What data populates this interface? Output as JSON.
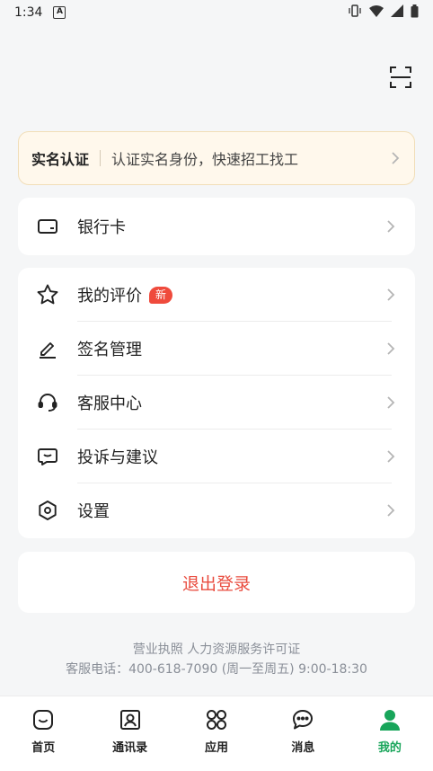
{
  "status_bar": {
    "time": "1:34",
    "notif_letter": "A"
  },
  "verify": {
    "title": "实名认证",
    "desc": "认证实名身份，快速招工找工"
  },
  "bank": {
    "label": "银行卡"
  },
  "menu": {
    "reviews": {
      "label": "我的评价",
      "badge": "新"
    },
    "signature": {
      "label": "签名管理"
    },
    "service": {
      "label": "客服中心"
    },
    "complaint": {
      "label": "投诉与建议"
    },
    "settings": {
      "label": "设置"
    }
  },
  "logout": {
    "label": "退出登录"
  },
  "footer": {
    "links": "营业执照 人力资源服务许可证",
    "phone": "客服电话：400-618-7090 (周一至周五) 9:00-18:30"
  },
  "tabs": [
    {
      "label": "首页"
    },
    {
      "label": "通讯录"
    },
    {
      "label": "应用"
    },
    {
      "label": "消息"
    },
    {
      "label": "我的"
    }
  ],
  "colors": {
    "accent": "#18a55a",
    "danger": "#e94c3f",
    "badge": "#ef4a3c",
    "verify_bg": "#fff8ec"
  }
}
